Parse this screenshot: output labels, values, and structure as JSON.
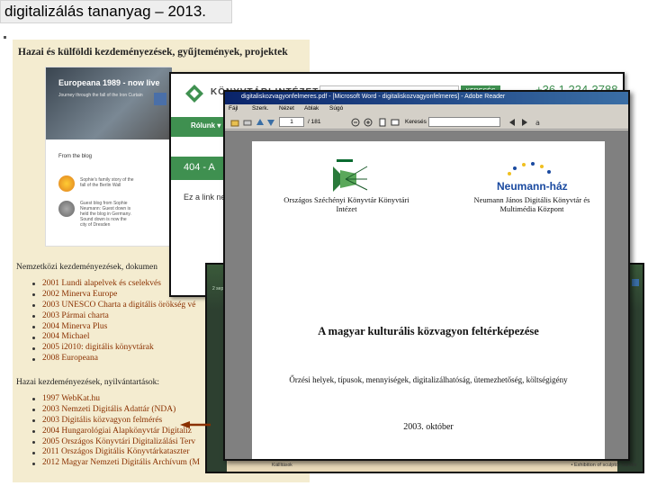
{
  "slide": {
    "title": "digitalizálás tananyag – 2013."
  },
  "background_page": {
    "heading": "Hazai és külföldi kezdeményezések, gyűjtemények, projektek",
    "europeana_card": {
      "banner_title": "Europeana 1989 - now live",
      "banner_sub": "Journey through the fall of the Iron Curtain",
      "blog_label": "From the blog",
      "note1": "Sophie's family story of the fall of the Berlin Wall",
      "note2": "Guest blog from Sophie Neumann: Guest down is held the blog in Germany. Sound down is now the city of Dresden"
    },
    "section_international": "Nemzetközi kezdeményezések, dokumen",
    "international_items": [
      "2001 Lundi alapelvek és cselekvés",
      "2002 Minerva Europe",
      "2003 UNESCO Charta a digitális örökség vé",
      "2003 Pármai charta",
      "2004 Minerva Plus",
      "2004 Michael",
      "2005 i2010: digitális könyvtárak",
      "2008 Europeana"
    ],
    "section_domestic": "Hazai kezdeményezések, nyilvántartások:",
    "domestic_items": [
      "1997 WebKat.hu",
      "2003 Nemzeti Digitális Adattár (NDA)",
      "2003 Digitális közvagyon felmérés",
      "2004 Hungarológiai Alapkönyvtár Digitaliz",
      "2005 Országos Könyvtári Digitalizálási Terv",
      "2011 Országos Digitális Könyvtárkataszter",
      "2012 Magyar Nemzeti Digitális Archívum (M"
    ]
  },
  "website_window": {
    "site_name": "KÖNYVTÁRI INTÉZET",
    "search_button": "KERESÉS",
    "phone": "+36 1 224-3788",
    "nav_item": "Rólunk ▾",
    "error_banner": "404 - A",
    "body_text": "Ez a link nem"
  },
  "pdf_viewer": {
    "title_bar": "digitaliskozvagyonfelmeres.pdf - [Microsoft Word - digitaliskozvagyonfelmeres] - Adobe Reader",
    "menu": [
      "Fájl",
      "Szerk.",
      "Nézet",
      "Ablak",
      "Súgó"
    ],
    "page_current": "1",
    "page_total": "/ 181",
    "search_label": "Keresés",
    "zoom_value": "",
    "document": {
      "org_left_logo_text": "Könyvtári Intézet",
      "org_left": "Országos Széchényi Könyvtár Könyvtári Intézet",
      "org_right_logo_text": "Neumann-ház",
      "org_right": "Neumann János Digitális Könyvtár és Multimédia Központ",
      "title": "A magyar kulturális közvagyon feltérképezése",
      "subtitle": "Őrzési helyek, típusok, mennyiségek, digitalizálhatóság, ütemezhetőség, költségigény",
      "date": "2003. október"
    }
  },
  "back_window": {
    "strip_text": "2 sep",
    "footer_left": "Kiállítások",
    "footer_right": "• Exhibition of sculptor Sándor"
  },
  "colors": {
    "scan_bg": "#f4ecd0",
    "link": "#8a3000",
    "site_green": "#3f9050",
    "neumann_blue": "#1a4aa0"
  }
}
